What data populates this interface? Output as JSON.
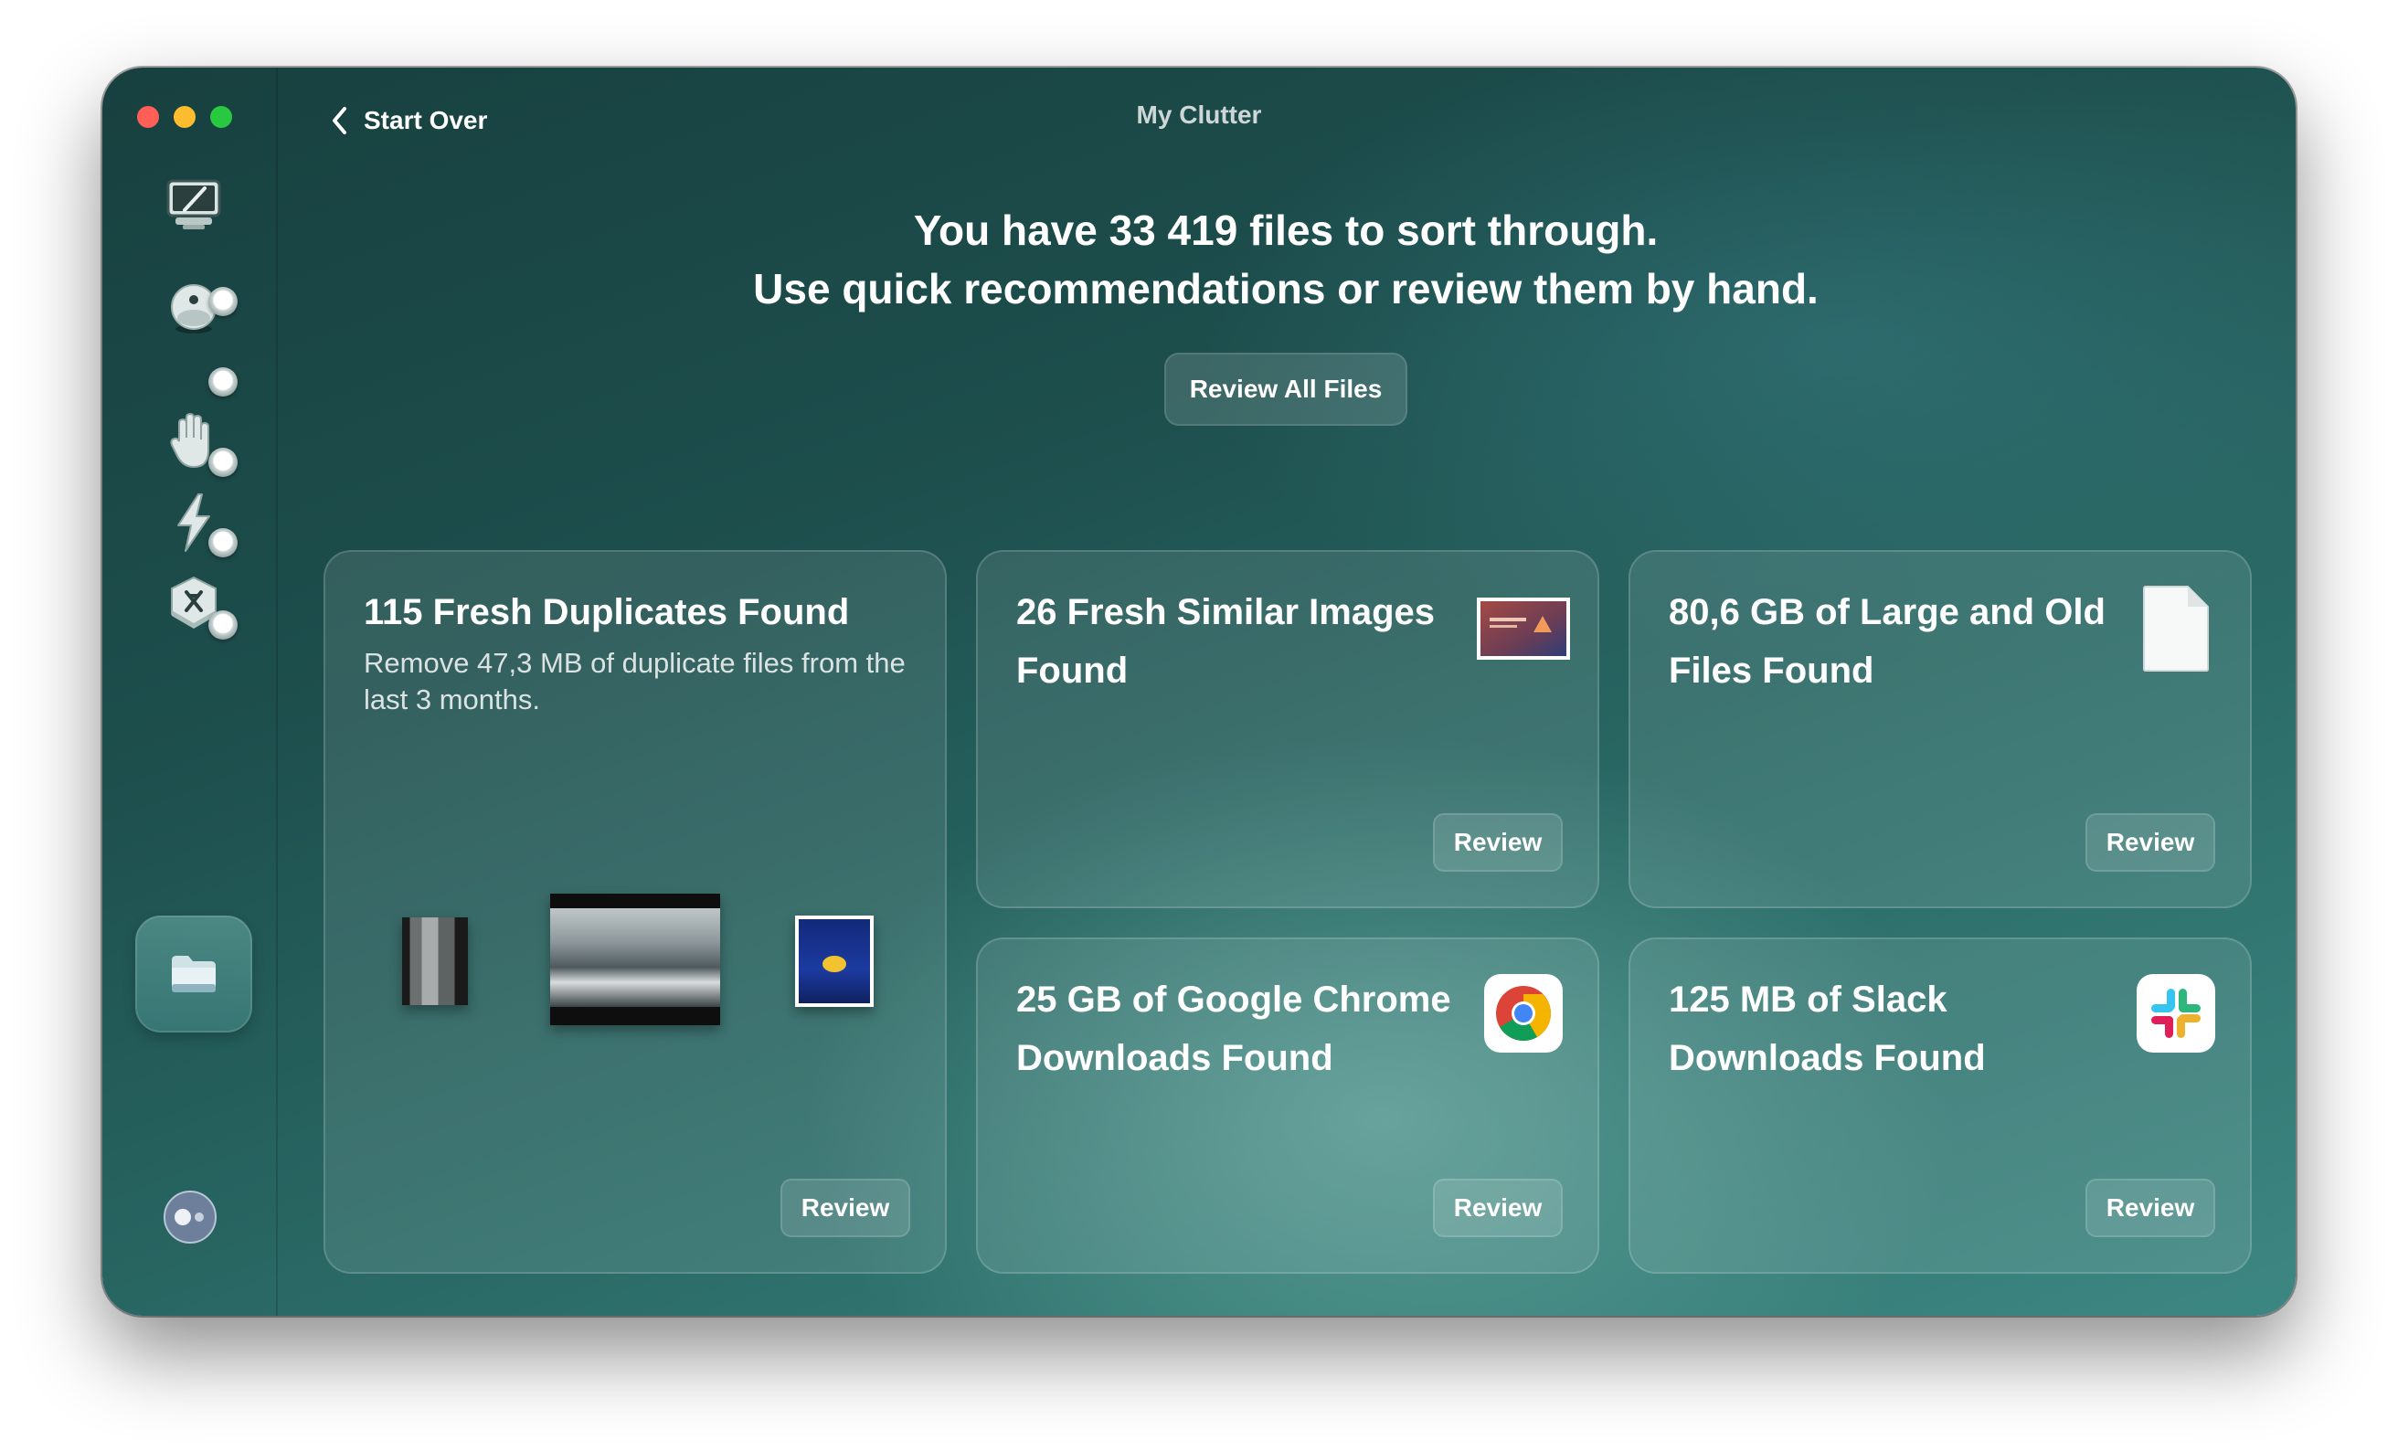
{
  "window": {
    "title": "My Clutter",
    "back_label": "Start Over"
  },
  "sidebar": {
    "items": [
      {
        "icon": "cleanup-monitor-icon",
        "label": "",
        "badge": false
      },
      {
        "icon": "protection-icon",
        "label": "",
        "badge": true
      },
      {
        "icon": "privacy-hand-icon",
        "label": "",
        "badge": true
      },
      {
        "icon": "speed-lightning-icon",
        "label": "",
        "badge": true
      },
      {
        "icon": "applications-icon",
        "label": "",
        "badge": true
      },
      {
        "icon": "my-clutter-folder-icon",
        "label": "",
        "badge": true,
        "active": true
      }
    ],
    "bottom_icon": "assistant-toggle-icon"
  },
  "header": {
    "line1": "You have 33 419 files to sort through.",
    "line2": "Use quick recommendations or review them by hand.",
    "review_all_label": "Review All Files"
  },
  "cards": {
    "duplicates": {
      "title": "115 Fresh Duplicates Found",
      "description": "Remove 47,3 MB of duplicate files from the last 3 months.",
      "button": "Review"
    },
    "similar_images": {
      "title_line1": "26 Fresh Similar Images",
      "title_line2": "Found",
      "icon": "image-thumbnail-icon",
      "button": "Review"
    },
    "large_old": {
      "title_line1": "80,6 GB of Large and Old",
      "title_line2": "Files Found",
      "icon": "document-icon",
      "button": "Review"
    },
    "chrome": {
      "title_line1": "25 GB of Google Chrome",
      "title_line2": "Downloads Found",
      "icon": "chrome-icon",
      "button": "Review"
    },
    "slack": {
      "title_line1": "125 MB of Slack",
      "title_line2": "Downloads Found",
      "icon": "slack-icon",
      "button": "Review"
    }
  },
  "colors": {
    "window_bg_dark": "#17403f",
    "window_bg_light": "#3d8782",
    "close": "#ff5f57",
    "minimize": "#febc2e",
    "zoom": "#28c840"
  }
}
